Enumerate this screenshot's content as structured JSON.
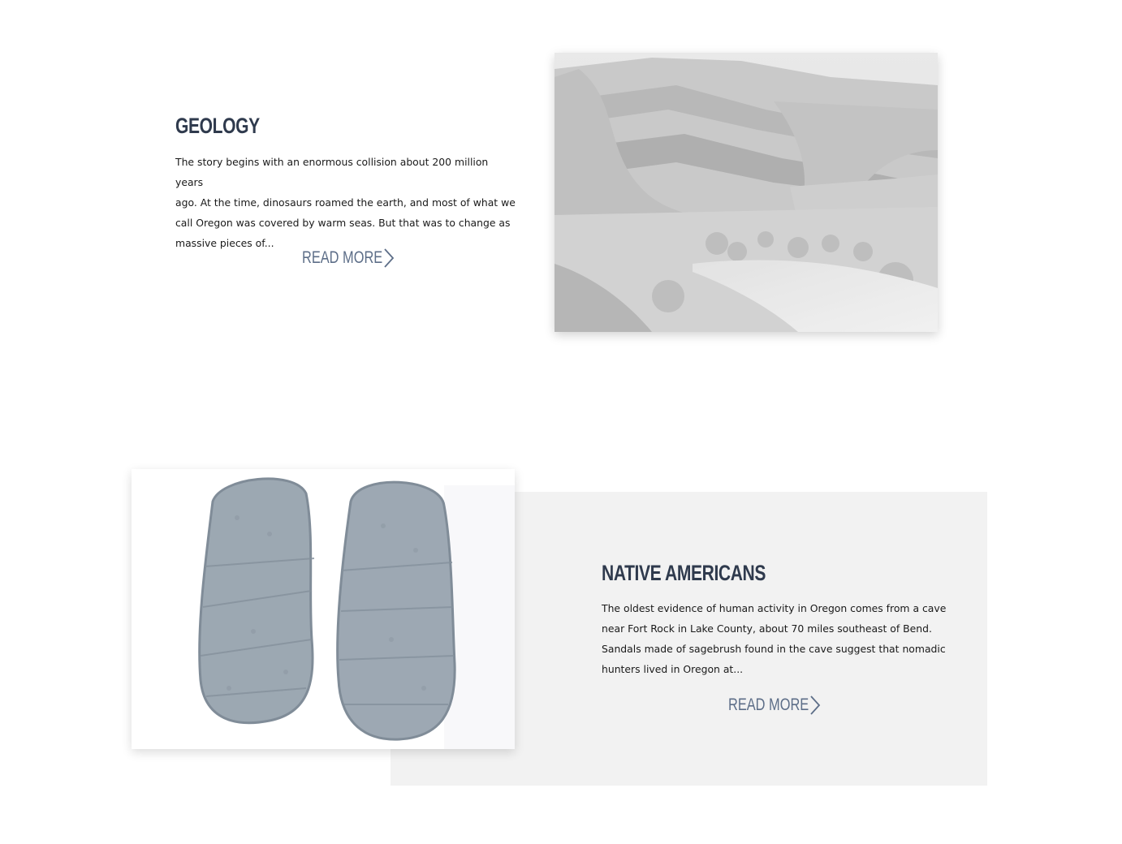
{
  "sections": [
    {
      "title": "GEOLOGY",
      "excerpt_lines": [
        "The story begins with an enormous collision about 200 million years",
        "ago. At the time, dinosaurs roamed the earth, and most of what we",
        "call Oregon was covered by warm seas. But that was to change as",
        "massive pieces of..."
      ],
      "link_label": "READ MORE",
      "image_icon": "canyon-photo"
    },
    {
      "title": "NATIVE AMERICANS",
      "excerpt_lines": [
        "The oldest evidence of human activity in Oregon comes from a cave",
        "near Fort Rock in Lake County, about 70 miles southeast of Bend.",
        "Sandals made of sagebrush found in the cave suggest that nomadic",
        "hunters lived in Oregon at..."
      ],
      "link_label": "READ MORE",
      "image_icon": "sagebrush-sandals-photo"
    }
  ],
  "colors": {
    "heading": "#2f3a4d",
    "link": "#5d6e88",
    "panel": "#f2f2f2",
    "text": "#1a1a1a"
  }
}
